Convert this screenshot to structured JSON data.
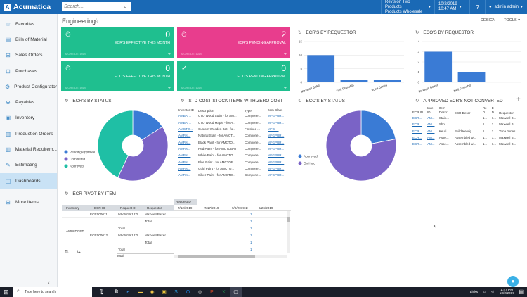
{
  "app": {
    "logo": "Acumatica",
    "search_placeholder": "Search...",
    "company_line1": "Revision Two Products",
    "company_line2": "Products Wholesale",
    "date": "10/2/2019",
    "time": "10:47 AM",
    "user": "admin admin"
  },
  "sidebar": {
    "items": [
      {
        "label": "Favorites",
        "icon": "star-icon"
      },
      {
        "label": "Bills of Material",
        "icon": "document-icon"
      },
      {
        "label": "Sales Orders",
        "icon": "cart-icon"
      },
      {
        "label": "Purchases",
        "icon": "cart-icon"
      },
      {
        "label": "Product Configurator",
        "icon": "gear-icon"
      },
      {
        "label": "Payables",
        "icon": "minus-circle-icon"
      },
      {
        "label": "Inventory",
        "icon": "box-icon"
      },
      {
        "label": "Production Orders",
        "icon": "factory-icon"
      },
      {
        "label": "Material Requirem...",
        "icon": "factory-icon"
      },
      {
        "label": "Estimating",
        "icon": "pencil-icon"
      },
      {
        "label": "Dashboards",
        "icon": "dashboard-icon"
      },
      {
        "label": "More Items",
        "icon": "grid-icon"
      }
    ],
    "collapse": "‹",
    "dots": "..."
  },
  "page": {
    "title": "Engineering",
    "design": "DESIGN",
    "tools": "TOOLS ▾"
  },
  "tiles": [
    {
      "value": "0",
      "label": "ECR'S EFFECTIVE THIS MONTH",
      "more": "MORE DETAILS",
      "color": "#1fbf8f"
    },
    {
      "value": "2",
      "label": "ECR'S PENDING APPROVAL",
      "more": "MORE DETAILS",
      "color": "#e83d8d"
    },
    {
      "value": "0",
      "label": "ECO'S EFFECTIVE THIS MONTH",
      "more": "MORE DETAILS",
      "color": "#1fbf8f"
    },
    {
      "value": "0",
      "label": "ECO'S PENDING APPROVAL",
      "more": "MORE DETAILS",
      "color": "#1fbf8f"
    }
  ],
  "widgets": {
    "ecr_by_requestor": "ECR'S BY REQUESTOR",
    "eco_by_requestor": "ECO'S BY REQUESTOR",
    "ecr_by_status": "ECR'S BY STATUS",
    "std_cost": "STD COST STOCK ITEMS WITH ZERO COST",
    "eco_by_status": "ECO'S BY STATUS",
    "approved_ecr": "APPROVED ECR'S NOT CONVERTED",
    "ecr_pivot": "ECR PIVOT BY ITEM"
  },
  "chart_data": [
    {
      "type": "bar",
      "title": "ECR'S BY REQUESTOR",
      "categories": [
        "Maxwell Baker",
        "Neil Franchis",
        "Yona Jones"
      ],
      "values": [
        10,
        1,
        1
      ],
      "ylim": [
        0,
        15
      ],
      "yticks": [
        0,
        5,
        10,
        15
      ]
    },
    {
      "type": "bar",
      "title": "ECO'S BY REQUESTOR",
      "categories": [
        "Maxwell Baker",
        "Neil Franchis"
      ],
      "values": [
        3,
        1
      ],
      "ylim": [
        0,
        4
      ],
      "yticks": [
        0,
        1,
        2,
        3,
        4
      ]
    },
    {
      "type": "pie",
      "title": "ECR'S BY STATUS",
      "legend": [
        "Pending Approval",
        "Completed",
        "Approved"
      ],
      "colors": [
        "#3a7bd5",
        "#7a63c6",
        "#1fbfa5"
      ],
      "values": [
        16,
        41,
        43
      ]
    },
    {
      "type": "pie",
      "title": "ECO'S BY STATUS",
      "legend": [
        "Approved",
        "On Hold"
      ],
      "colors": [
        "#3a7bd5",
        "#7a63c6"
      ],
      "values": [
        22,
        78
      ]
    }
  ],
  "std_table": {
    "headers": [
      "Inventor ID",
      "Description",
      "Type",
      "Item Class"
    ],
    "rows": [
      [
        "AMBAT...",
        "CTO Wood Stain - for AM...",
        "Compone...",
        "MFGPUR..."
      ],
      [
        "AMBAT...",
        "CTO Wood Maple - for A...",
        "Compone...",
        "MFGPUR..."
      ],
      [
        "AMCTO...",
        "Custom Wooden Bat - fo...",
        "Finished ...",
        "MFG - -"
      ],
      [
        "AMPAI...",
        "Natural Stain - for AMCT...",
        "Compone...",
        "MFGPUR..."
      ],
      [
        "AMPAI...",
        "Black Paint - for AMCTO...",
        "Compone...",
        "MFGPUR..."
      ],
      [
        "AMPAI...",
        "Red Paint - for AMCTOBAT",
        "Compone...",
        "MFGPUR..."
      ],
      [
        "AMPAI...",
        "White Paint - for AMCTO...",
        "Compone...",
        "MFGPUR..."
      ],
      [
        "AMPAI...",
        "Blue Paint - for AMCTOB...",
        "Compone...",
        "MFGPUR..."
      ],
      [
        "AMPAI...",
        "Gold Paint - for AMCTO...",
        "Compone...",
        "MFGPUR..."
      ],
      [
        "AMPAI...",
        "Silver Paint - for AMCTO...",
        "Compone...",
        "MFGPUR..."
      ]
    ]
  },
  "ecr_table": {
    "headers": [
      "ECR ID",
      "Inve ID",
      "Item Descr",
      "ECR Descr",
      "Re D",
      "E D",
      "Requestor"
    ],
    "rows": [
      [
        "ECR...",
        "AM...",
        "Stain...",
        "",
        "1...",
        "1...",
        "Maxwell B..."
      ],
      [
        "ECR...",
        "AM...",
        "Sho...",
        "",
        "1...",
        "1...",
        "Maxwell B..."
      ],
      [
        "ECR...",
        "AM...",
        "Keuri...",
        "Build Keurig ...",
        "1...",
        "1...",
        "Yona Jones"
      ],
      [
        "ECR...",
        "AM...",
        "Asse...",
        "Assembled wi...",
        "1...",
        "1...",
        "Maxwell B..."
      ],
      [
        "ECR...",
        "AM...",
        "Asse...",
        "Assembled wi...",
        "1...",
        "1...",
        "Maxwell B..."
      ]
    ]
  },
  "pivot": {
    "top_header": "Request D",
    "col_headers": [
      "Inventory",
      "ECR ID",
      "Request D",
      "Requestor"
    ],
    "dates": [
      "7/12/2019",
      "7/17/2019",
      "9/9/2019 1:",
      "9/26/2019"
    ],
    "item": "AMWIDGET",
    "rows": [
      {
        "ecr": "ECR000011",
        "date": "9/9/2019 12:0",
        "req": "Maxwell Baker",
        "val": "1"
      },
      {
        "ecr": "",
        "date": "",
        "req": "Total",
        "val": "1"
      },
      {
        "ecr": "",
        "date": "Total",
        "req": "",
        "val": "1"
      },
      {
        "ecr": "ECR000012",
        "date": "9/9/2019 12:0",
        "req": "Maxwell Baker",
        "val": "1"
      },
      {
        "ecr": "",
        "date": "",
        "req": "Total",
        "val": "1"
      },
      {
        "ecr": "",
        "date": "Total",
        "req": "",
        "val": "1"
      }
    ],
    "total": "Total"
  },
  "taskbar": {
    "search": "Type here to search",
    "tray_links": "Links",
    "time": "1:47 PM",
    "date": "10/2/2019"
  }
}
